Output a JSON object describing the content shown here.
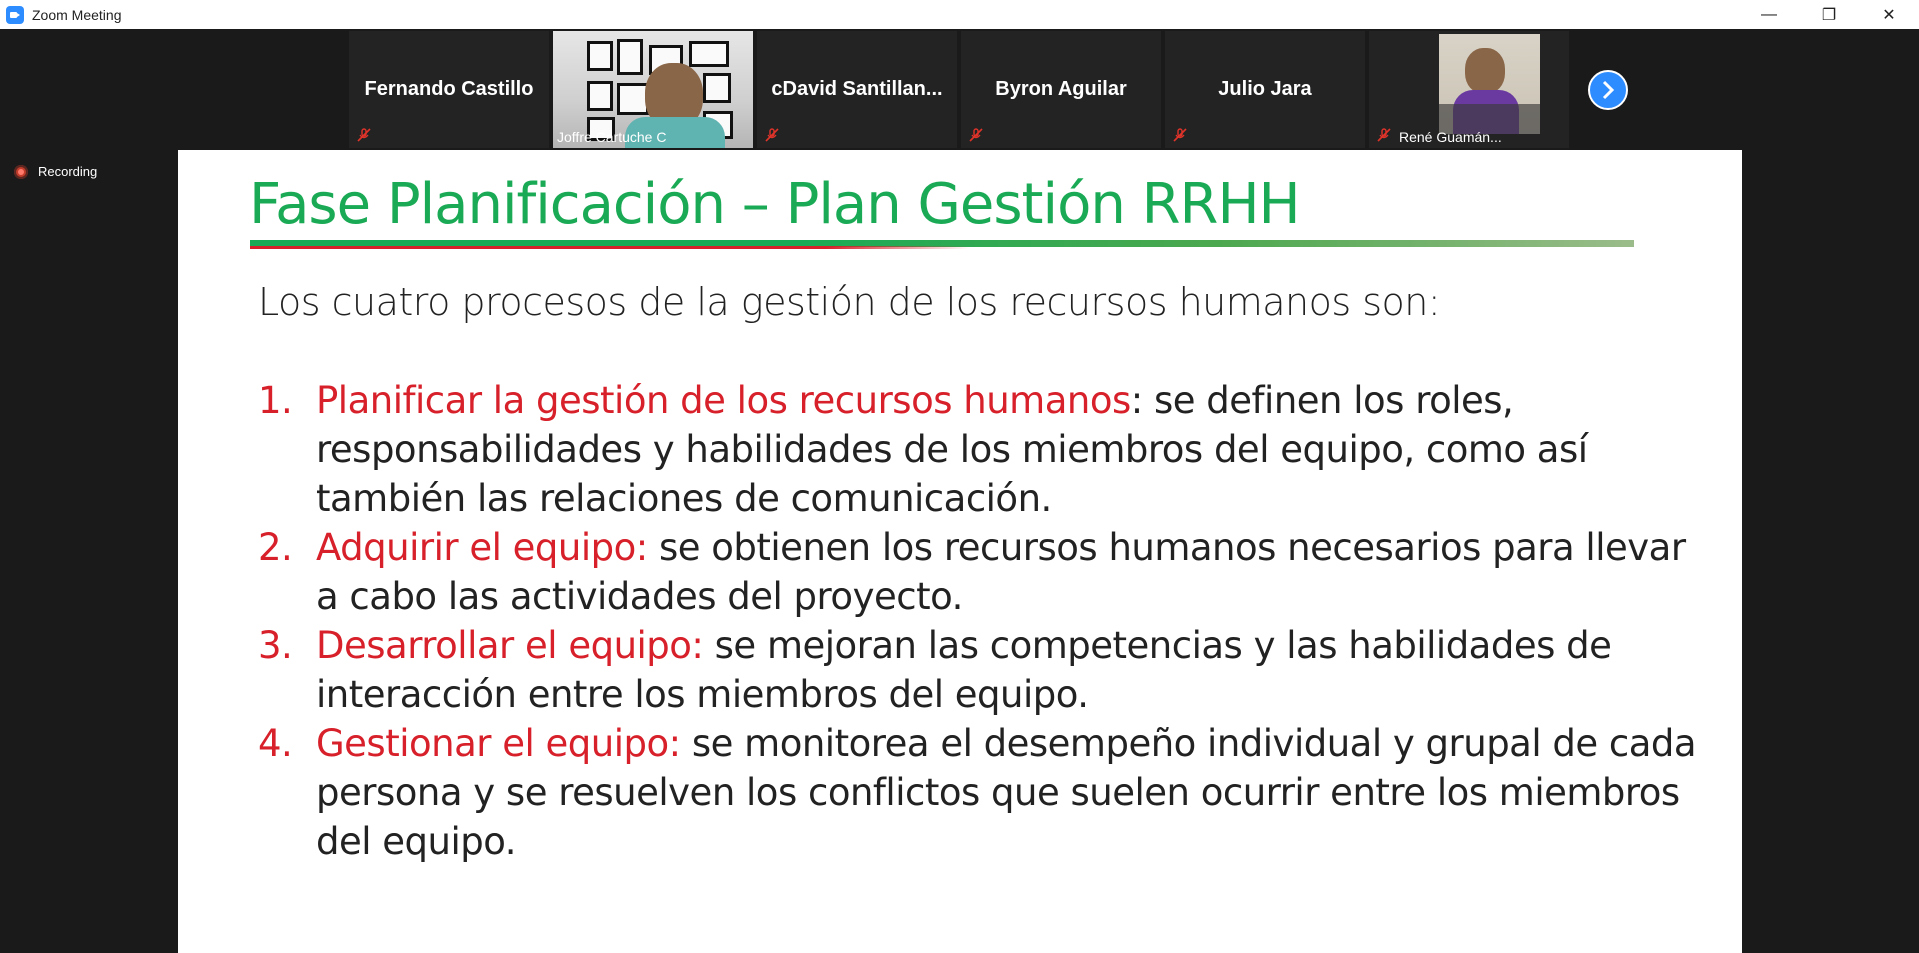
{
  "window": {
    "title": "Zoom Meeting",
    "controls": {
      "minimize": "—",
      "restore": "❐",
      "close": "✕"
    }
  },
  "participants": [
    {
      "name": "Fernando Castillo",
      "muted": true,
      "video": false
    },
    {
      "name": "Joffre Cartuche C",
      "muted": false,
      "video": true,
      "active_speaker": true
    },
    {
      "name": "cDavid  Santillan...",
      "muted": true,
      "video": false
    },
    {
      "name": "Byron Aguilar",
      "muted": true,
      "video": false
    },
    {
      "name": "Julio Jara",
      "muted": true,
      "video": false
    },
    {
      "name": "René Guamán...",
      "muted": true,
      "video": true
    }
  ],
  "recording": {
    "label": "Recording"
  },
  "slide": {
    "title": "Fase Planificación – Plan Gestión RRHH",
    "intro": "Los cuatro procesos de la gestión de los recursos humanos son:",
    "items": [
      {
        "num": "1.",
        "term": "Planificar la gestión de los recursos humanos",
        "text": ": se definen los roles, responsabilidades y habilidades de los miembros del equipo, como así también las relaciones de comunicación."
      },
      {
        "num": "2.",
        "term": "Adquirir el equipo:",
        "text": " se obtienen los recursos humanos necesarios para llevar a cabo las actividades del proyecto."
      },
      {
        "num": "3.",
        "term": "Desarrollar el equipo:",
        "text": " se mejoran las competencias y las habilidades de interacción entre los miembros del equipo."
      },
      {
        "num": "4.",
        "term": "Gestionar el equipo:",
        "text": " se monitorea el desempeño individual y grupal de cada persona y se resuelven los conflictos que suelen ocurrir entre los miembros del equipo."
      }
    ]
  },
  "colors": {
    "accent_green": "#1aaa55",
    "accent_red": "#d7202a",
    "zoom_blue": "#2d8cff",
    "active_speaker": "#a6d43a"
  }
}
